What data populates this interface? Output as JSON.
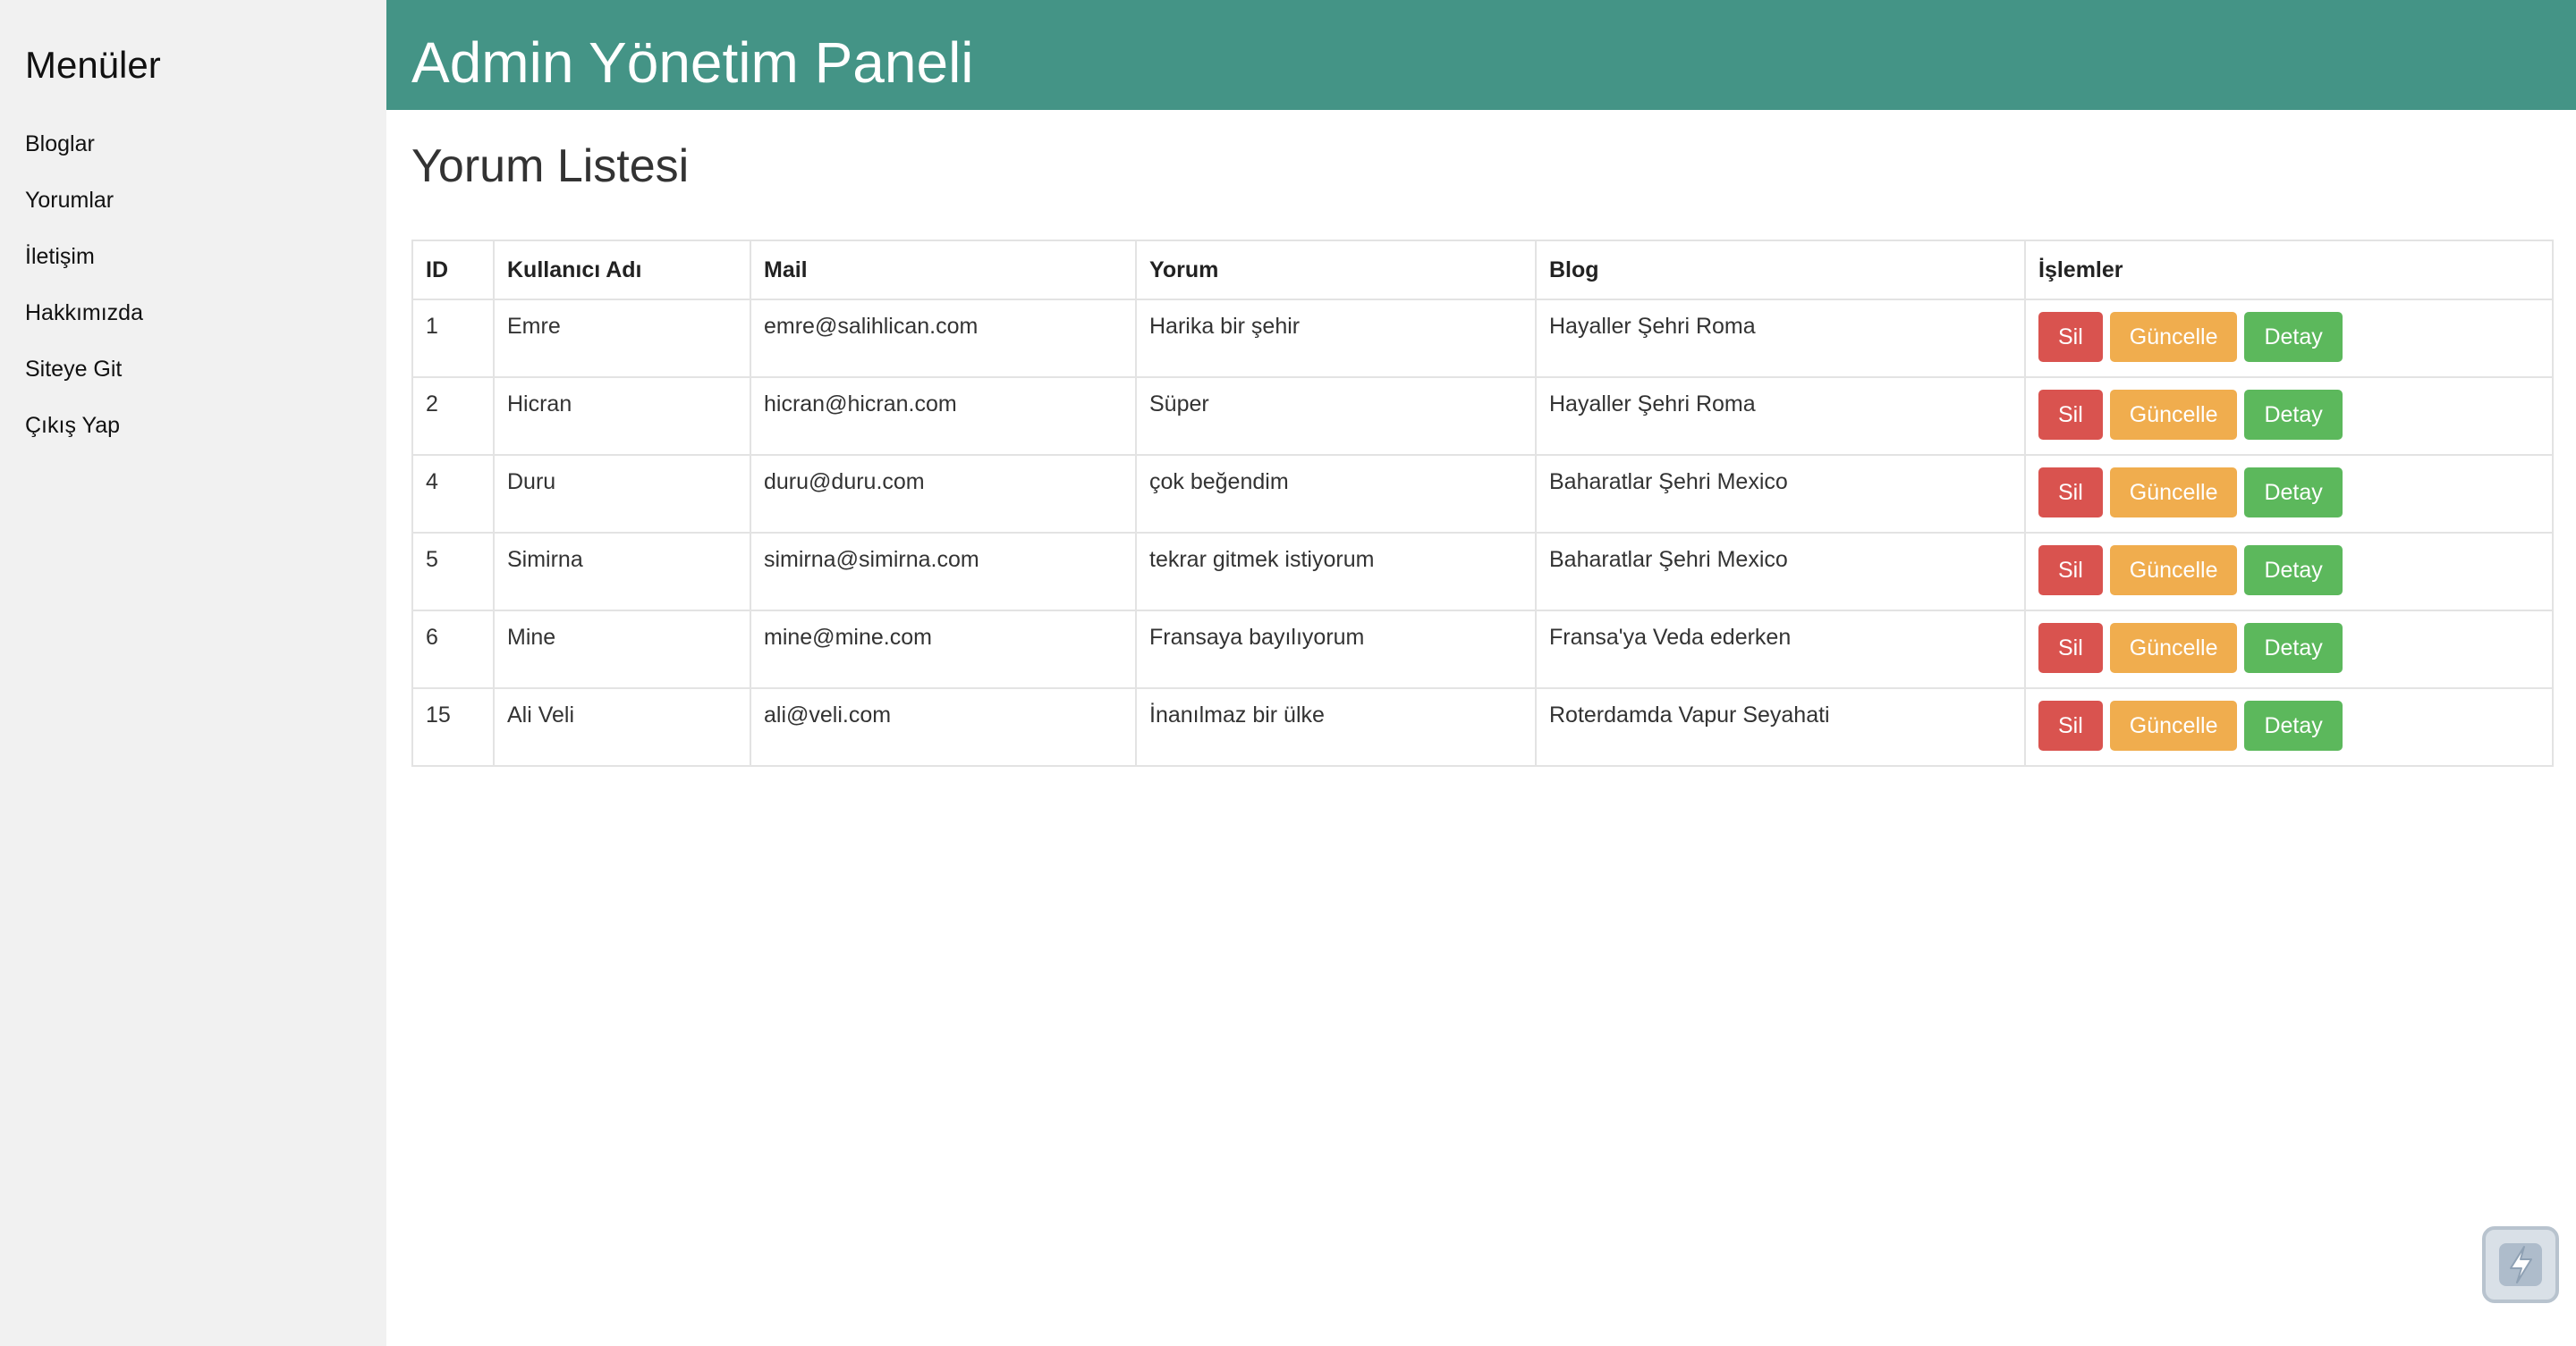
{
  "sidebar": {
    "title": "Menüler",
    "items": [
      {
        "label": "Bloglar"
      },
      {
        "label": "Yorumlar"
      },
      {
        "label": "İletişim"
      },
      {
        "label": "Hakkımızda"
      },
      {
        "label": "Siteye Git"
      },
      {
        "label": "Çıkış Yap"
      }
    ]
  },
  "header": {
    "title": "Admin Yönetim Paneli"
  },
  "main": {
    "title": "Yorum Listesi",
    "table": {
      "columns": [
        "ID",
        "Kullanıcı Adı",
        "Mail",
        "Yorum",
        "Blog",
        "İşlemler"
      ],
      "rows": [
        {
          "id": "1",
          "username": "Emre",
          "mail": "emre@salihlican.com",
          "comment": "Harika bir şehir",
          "blog": "Hayaller Şehri Roma"
        },
        {
          "id": "2",
          "username": "Hicran",
          "mail": "hicran@hicran.com",
          "comment": "Süper",
          "blog": "Hayaller Şehri Roma"
        },
        {
          "id": "4",
          "username": "Duru",
          "mail": "duru@duru.com",
          "comment": "çok beğendim",
          "blog": "Baharatlar Şehri Mexico"
        },
        {
          "id": "5",
          "username": "Simirna",
          "mail": "simirna@simirna.com",
          "comment": "tekrar gitmek istiyorum",
          "blog": "Baharatlar Şehri Mexico"
        },
        {
          "id": "6",
          "username": "Mine",
          "mail": "mine@mine.com",
          "comment": "Fransaya bayılıyorum",
          "blog": "Fransa'ya Veda ederken"
        },
        {
          "id": "15",
          "username": "Ali Veli",
          "mail": "ali@veli.com",
          "comment": "İnanılmaz bir ülke",
          "blog": "Roterdamda Vapur Seyahati"
        }
      ],
      "actions": {
        "delete": "Sil",
        "update": "Güncelle",
        "detail": "Detay"
      }
    }
  },
  "colors": {
    "header": "#449486",
    "sidebar": "#f1f1f1",
    "delete": "#d9534f",
    "update": "#f0ad4e",
    "detail": "#5cb85c"
  },
  "floating_widget": {
    "icon": "lightning-bolt-icon"
  }
}
